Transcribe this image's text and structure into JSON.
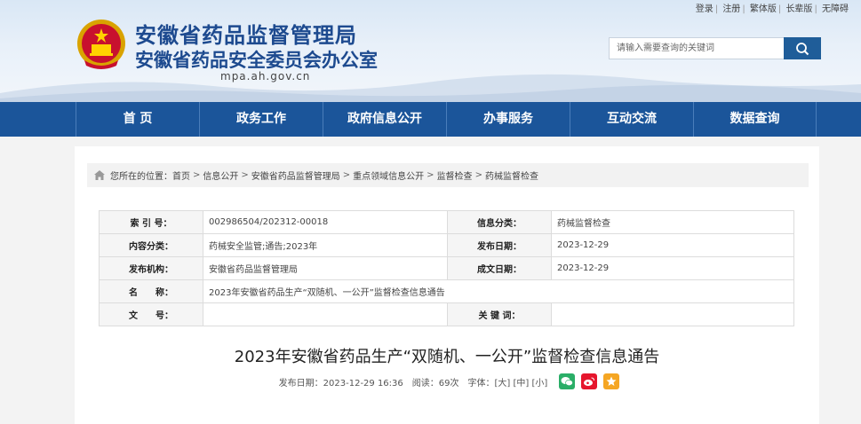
{
  "toplinks": [
    "登录",
    "注册",
    "繁体版",
    "长辈版",
    "无障碍"
  ],
  "header": {
    "title_main": "安徽省药品监督管理局",
    "title_sub": "安徽省药品安全委员会办公室",
    "domain": "mpa.ah.gov.cn"
  },
  "search": {
    "placeholder": "请输入需要查询的关键词"
  },
  "nav": [
    "首 页",
    "政务工作",
    "政府信息公开",
    "办事服务",
    "互动交流",
    "数据查询"
  ],
  "breadcrumb": {
    "prefix": "您所在的位置：",
    "items": [
      "首页",
      "信息公开",
      "安徽省药品监督管理局",
      "重点领域信息公开",
      "监督检查",
      "药械监督检查"
    ]
  },
  "meta": {
    "index_label": "索 引 号：",
    "index_value": "002986504/202312-00018",
    "category_label": "信息分类：",
    "category_value": "药械监督检查",
    "content_label": "内容分类：",
    "content_value": "药械安全监管;通告;2023年",
    "pubdate_label": "发布日期：",
    "pubdate_value": "2023-12-29",
    "org_label": "发布机构：",
    "org_value": "安徽省药品监督管理局",
    "createdate_label": "成文日期：",
    "createdate_value": "2023-12-29",
    "name_label": "名　　称：",
    "name_value": "2023年安徽省药品生产“双随机、一公开”监督检查信息通告",
    "docno_label": "文　　号：",
    "docno_value": "",
    "keywords_label": "关 键 词：",
    "keywords_value": ""
  },
  "article": {
    "title": "2023年安徽省药品生产“双随机、一公开”监督检查信息通告",
    "date": "发布日期：2023-12-29 16:36",
    "views": "阅读：69次",
    "fontsize_label": "字体：",
    "fontsize_options": [
      "[大]",
      "[中]",
      "[小]"
    ]
  },
  "share_icons": [
    "wechat-icon",
    "weibo-icon",
    "favorite-icon"
  ],
  "colors": {
    "nav_bg": "#1b559a",
    "title_blue": "#1d4a8f",
    "wechat": "#2aae67",
    "weibo": "#e6162d",
    "favorite": "#f5a623"
  }
}
